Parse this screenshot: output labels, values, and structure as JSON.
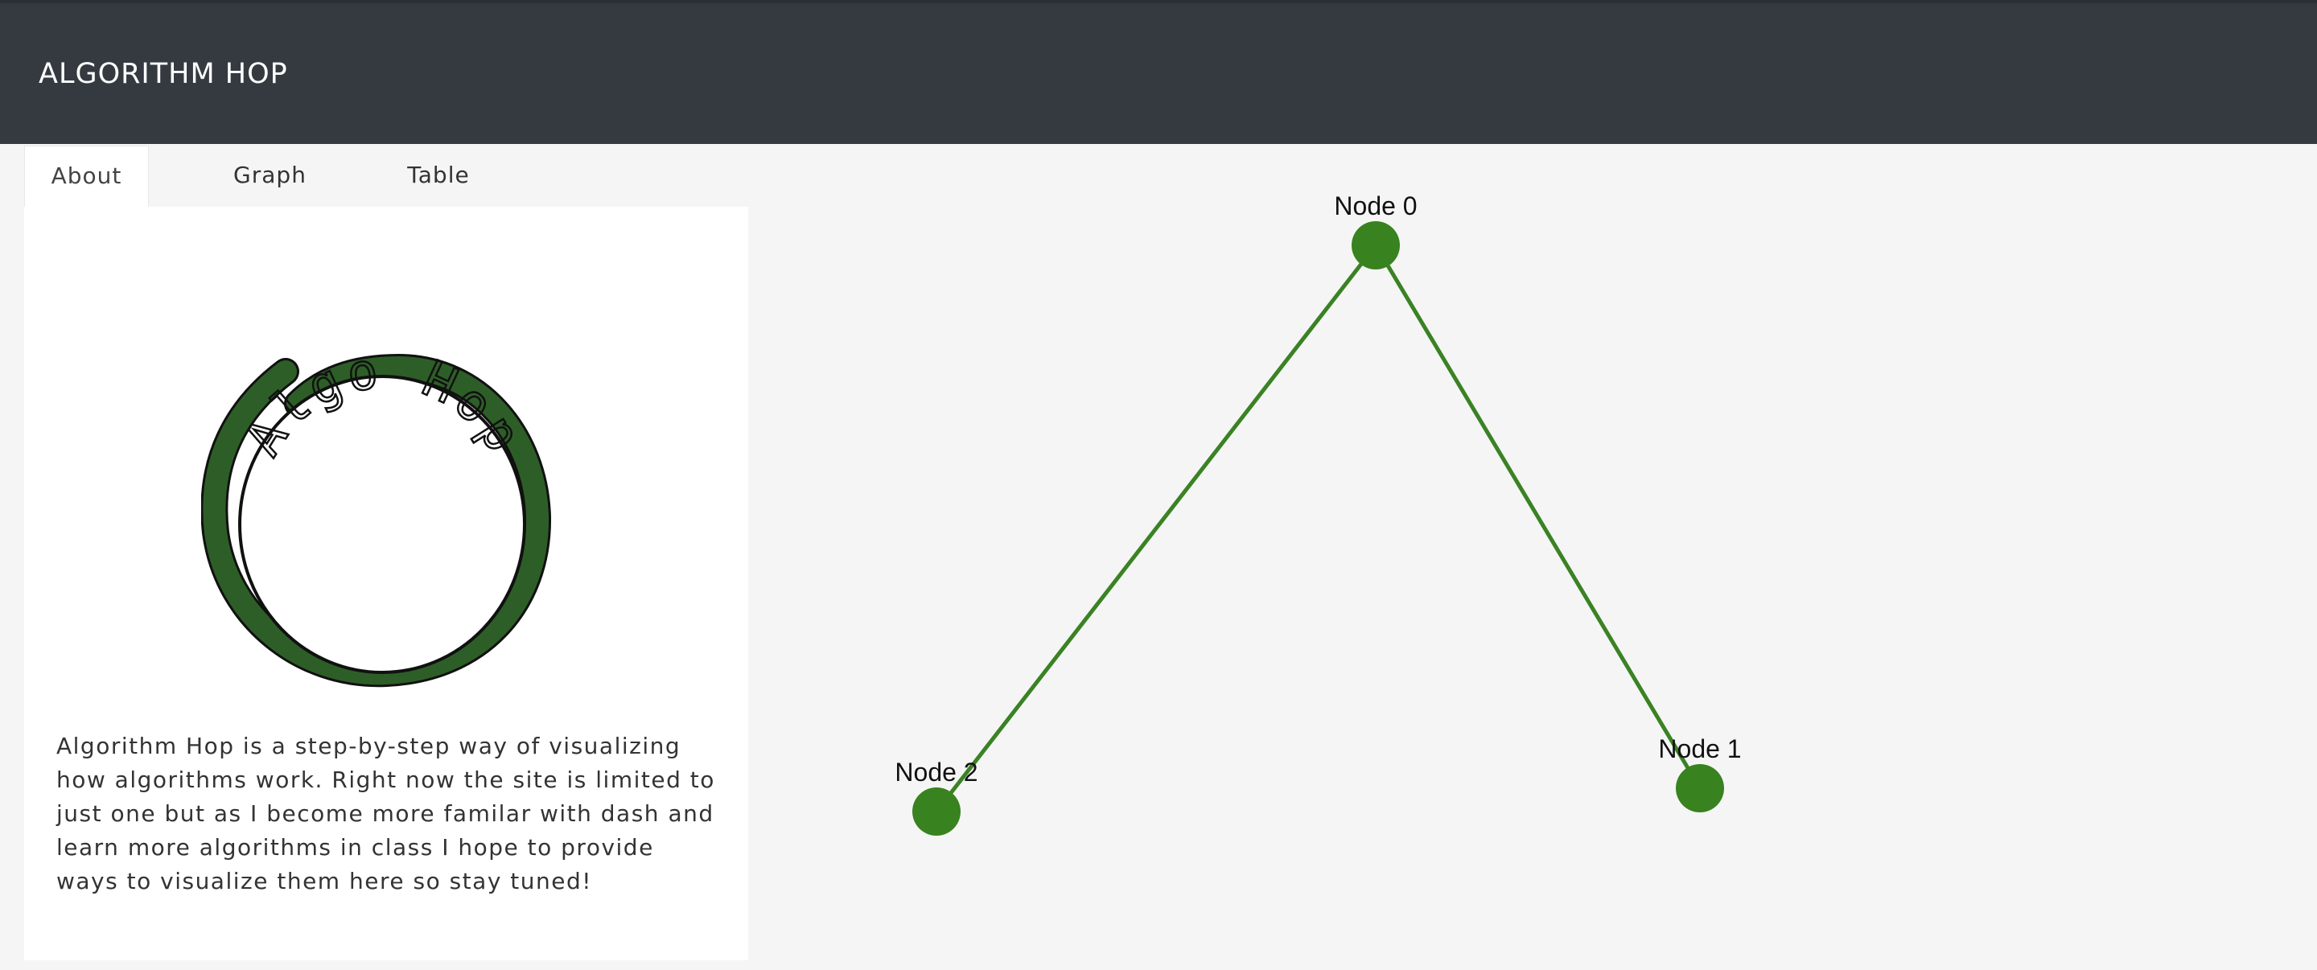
{
  "header": {
    "title": "ALGORITHM HOP"
  },
  "tabs": [
    {
      "label": "About",
      "active": true
    },
    {
      "label": "Graph",
      "active": false
    },
    {
      "label": "Table",
      "active": false
    }
  ],
  "about": {
    "logo_text": "Algo Hop",
    "description": "Algorithm Hop is a step-by-step way of visualizing how algorithms work. Right now the site is limited to just one but as I become more familar with dash and learn more algorithms in class I hope to provide ways to visualize them here so stay tuned!"
  },
  "graph": {
    "nodes": [
      {
        "id": 0,
        "label": "Node 0"
      },
      {
        "id": 1,
        "label": "Node 1"
      },
      {
        "id": 2,
        "label": "Node 2"
      }
    ],
    "edges": [
      [
        0,
        1
      ],
      [
        0,
        2
      ]
    ],
    "colors": {
      "node": "#38821f",
      "edge": "#3a8224"
    }
  },
  "colors": {
    "navbar": "#343a40",
    "logo_ring": "#2e5e27"
  }
}
